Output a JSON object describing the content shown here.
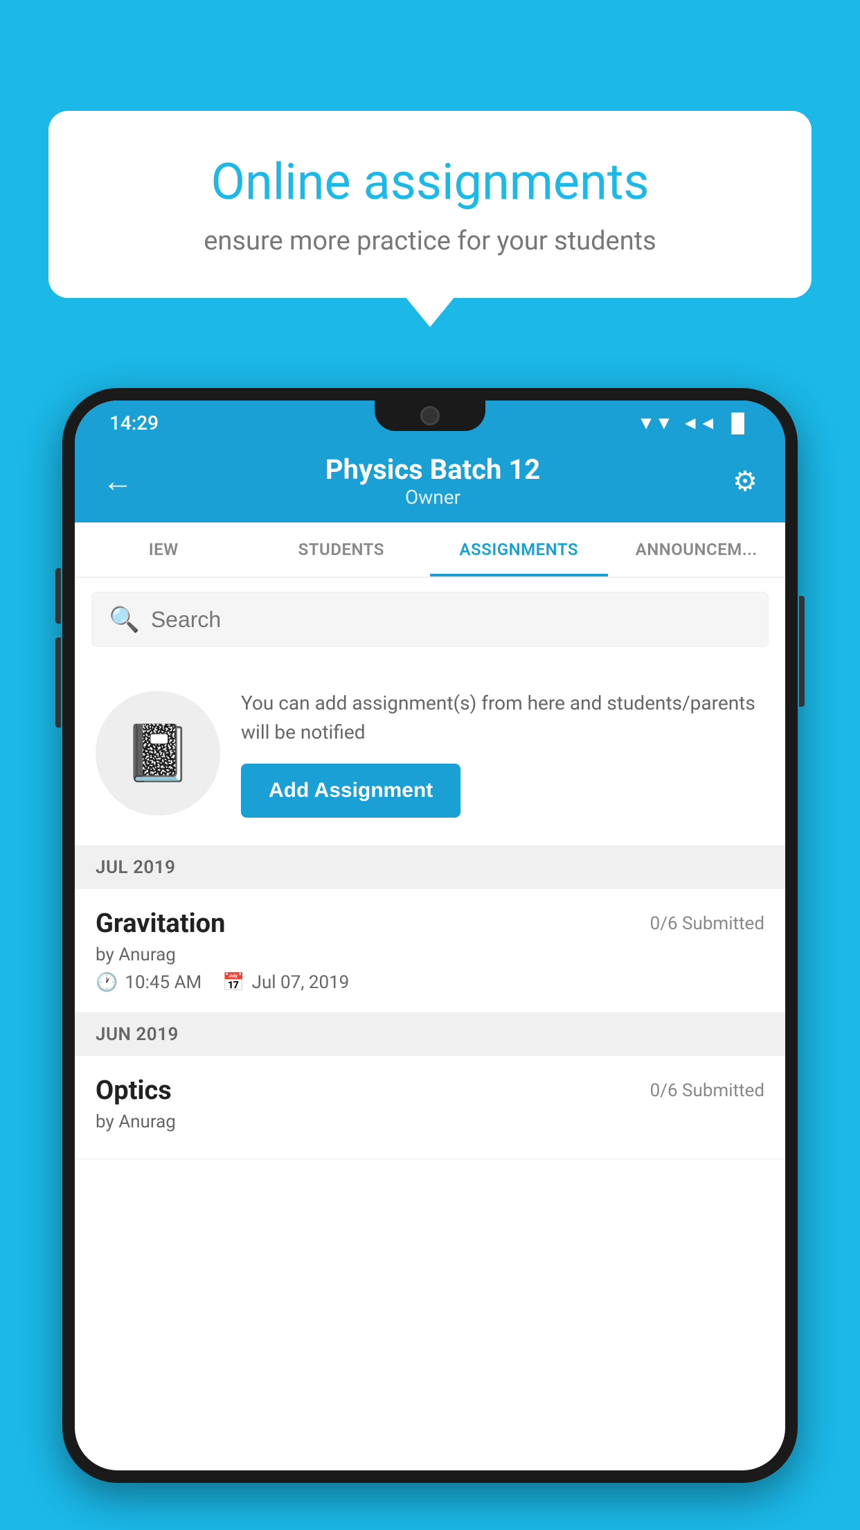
{
  "background_color": "#1bb8e8",
  "speech_bubble": {
    "title": "Online assignments",
    "subtitle": "ensure more practice for your students"
  },
  "status_bar": {
    "time": "14:29",
    "wifi": "▲",
    "signal": "◄",
    "battery": "▐"
  },
  "header": {
    "title": "Physics Batch 12",
    "subtitle": "Owner",
    "back_label": "←",
    "settings_label": "⚙"
  },
  "tabs": [
    {
      "id": "iew",
      "label": "IEW",
      "active": false
    },
    {
      "id": "students",
      "label": "STUDENTS",
      "active": false
    },
    {
      "id": "assignments",
      "label": "ASSIGNMENTS",
      "active": true
    },
    {
      "id": "announcements",
      "label": "ANNOUNCEM...",
      "active": false
    }
  ],
  "search": {
    "placeholder": "Search"
  },
  "empty_state": {
    "description": "You can add assignment(s) from here and students/parents will be notified",
    "button_label": "Add Assignment"
  },
  "sections": [
    {
      "header": "JUL 2019",
      "assignments": [
        {
          "name": "Gravitation",
          "submitted": "0/6 Submitted",
          "by": "by Anurag",
          "time": "10:45 AM",
          "date": "Jul 07, 2019"
        }
      ]
    },
    {
      "header": "JUN 2019",
      "assignments": [
        {
          "name": "Optics",
          "submitted": "0/6 Submitted",
          "by": "by Anurag",
          "time": "",
          "date": ""
        }
      ]
    }
  ]
}
